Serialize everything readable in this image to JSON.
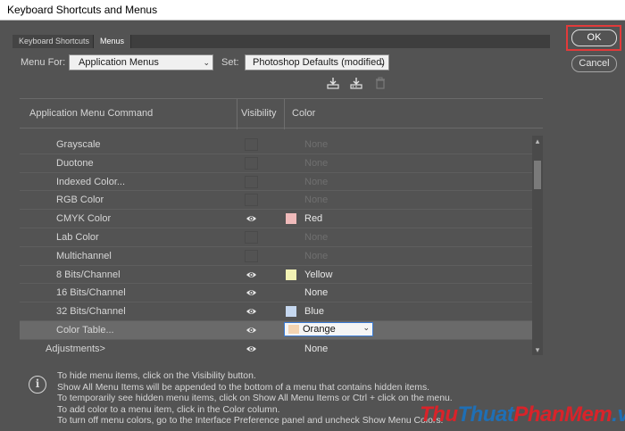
{
  "window": {
    "title": "Keyboard Shortcuts and Menus"
  },
  "tabs": [
    {
      "label": "Keyboard Shortcuts"
    },
    {
      "label": "Menus"
    }
  ],
  "menu_for": {
    "label": "Menu For:",
    "value": "Application Menus"
  },
  "set": {
    "label": "Set:",
    "value": "Photoshop Defaults (modified)"
  },
  "toolbar": {
    "icons": [
      "save-set-icon",
      "save-as-icon",
      "delete-icon"
    ]
  },
  "table": {
    "headers": {
      "command": "Application Menu Command",
      "visibility": "Visibility",
      "color": "Color"
    },
    "rows": [
      {
        "name": "Grayscale",
        "visible": false,
        "color": "None",
        "dim": true
      },
      {
        "name": "Duotone",
        "visible": false,
        "color": "None",
        "dim": true
      },
      {
        "name": "Indexed Color...",
        "visible": false,
        "color": "None",
        "dim": true
      },
      {
        "name": "RGB Color",
        "visible": false,
        "color": "None",
        "dim": true
      },
      {
        "name": "CMYK Color",
        "visible": true,
        "color": "Red",
        "swatch": "#efbaba"
      },
      {
        "name": "Lab Color",
        "visible": false,
        "color": "None",
        "dim": true
      },
      {
        "name": "Multichannel",
        "visible": false,
        "color": "None",
        "dim": true
      },
      {
        "name": "8 Bits/Channel",
        "visible": true,
        "color": "Yellow",
        "swatch": "#f2f2b4"
      },
      {
        "name": "16 Bits/Channel",
        "visible": true,
        "color": "None"
      },
      {
        "name": "32 Bits/Channel",
        "visible": true,
        "color": "Blue",
        "swatch": "#c5d7ef"
      },
      {
        "name": "Color Table...",
        "visible": true,
        "color": "Orange",
        "swatch": "#f3d4b2",
        "selected": true
      },
      {
        "name": "Adjustments>",
        "visible": true,
        "color": "None",
        "top": true
      }
    ]
  },
  "info_lines": [
    "To hide menu items, click on the Visibility button.",
    "Show All Menu Items will be appended to the bottom of a menu that contains hidden items.",
    "To temporarily see hidden menu items, click on Show All Menu Items or Ctrl + click on the menu.",
    "To add color to a menu item, click in the Color column.",
    "To turn off menu colors, go to the Interface Preference panel and uncheck Show Menu Colors."
  ],
  "buttons": {
    "ok": "OK",
    "cancel": "Cancel"
  },
  "watermark": {
    "part1": "Thu",
    "part2": "Thuat",
    "part3": "PhanMem",
    "part4": ".vn"
  },
  "colors": {
    "highlight": "#e23a3a",
    "background": "#535353",
    "watermark_red": "#d9232a",
    "watermark_blue": "#1f6fb5"
  }
}
